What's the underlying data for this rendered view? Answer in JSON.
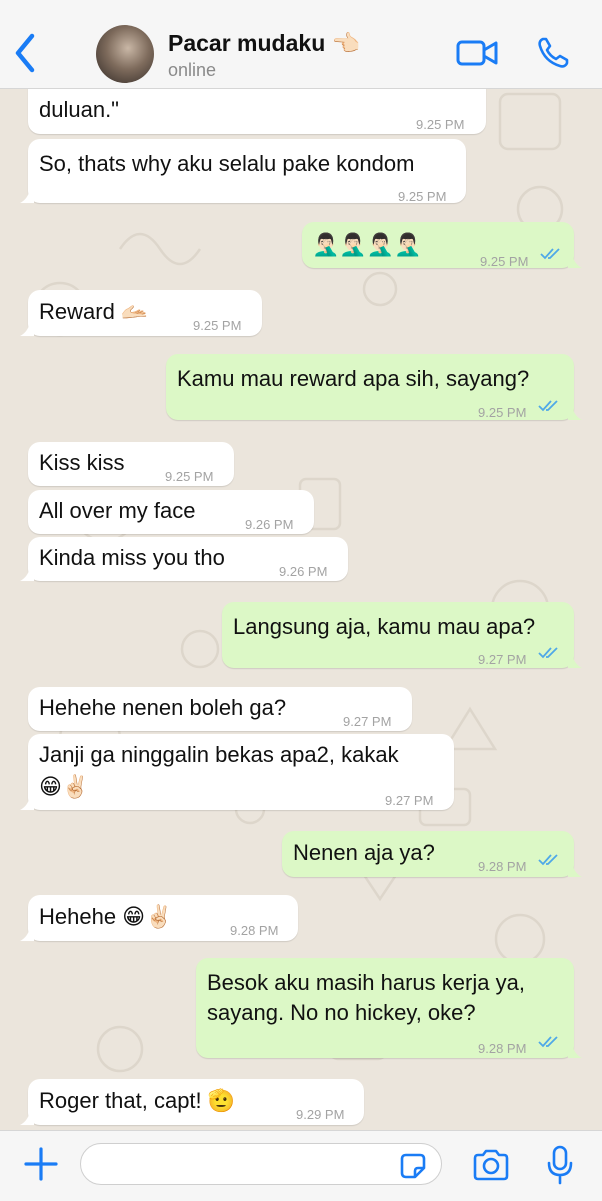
{
  "header": {
    "contact_name": "Pacar mudaku 👈🏻",
    "status": "online"
  },
  "messages": [
    {
      "dir": "in",
      "text": "duluan.\"",
      "time": "9.25 PM"
    },
    {
      "dir": "in",
      "text": "So, thats why aku selalu pake kondom",
      "time": "9.25 PM"
    },
    {
      "dir": "out",
      "text": "🤦🏻‍♂️🤦🏻‍♂️🤦🏻‍♂️🤦🏻‍♂️",
      "time": "9.25 PM",
      "ticks": "read"
    },
    {
      "dir": "in",
      "text": "Reward 🫴🏻",
      "time": "9.25 PM"
    },
    {
      "dir": "out",
      "text": "Kamu mau reward apa sih, sayang?",
      "time": "9.25 PM",
      "ticks": "read"
    },
    {
      "dir": "in",
      "text": "Kiss kiss",
      "time": "9.25 PM"
    },
    {
      "dir": "in",
      "text": "All over my face",
      "time": "9.26 PM"
    },
    {
      "dir": "in",
      "text": "Kinda miss you tho",
      "time": "9.26 PM"
    },
    {
      "dir": "out",
      "text": "Langsung aja, kamu mau apa?",
      "time": "9.27 PM",
      "ticks": "read"
    },
    {
      "dir": "in",
      "text": "Hehehe nenen boleh ga?",
      "time": "9.27 PM"
    },
    {
      "dir": "in",
      "text_line1": "Janji ga ninggalin bekas apa2, kakak",
      "text_line2": "😁✌🏻",
      "time": "9.27 PM"
    },
    {
      "dir": "out",
      "text": "Nenen aja ya?",
      "time": "9.28 PM",
      "ticks": "read"
    },
    {
      "dir": "in",
      "text": "Hehehe 😁✌🏻",
      "time": "9.28 PM"
    },
    {
      "dir": "out",
      "text_line1": "Besok aku masih harus kerja ya,",
      "text_line2": "sayang. No no hickey, oke?",
      "time": "9.28 PM",
      "ticks": "read"
    },
    {
      "dir": "in",
      "text": "Roger that, capt! 🫡",
      "time": "9.29 PM"
    }
  ],
  "composer": {
    "placeholder": ""
  },
  "colors": {
    "accent": "#1a7cf5",
    "outgoing_bubble": "#dcf8c6",
    "incoming_bubble": "#ffffff",
    "read_tick": "#4fa8e8",
    "background": "#ebe5dc"
  },
  "icons": [
    "back-chevron-icon",
    "video-call-icon",
    "phone-icon",
    "plus-icon",
    "sticker-icon",
    "camera-icon",
    "microphone-icon",
    "double-check-icon"
  ]
}
